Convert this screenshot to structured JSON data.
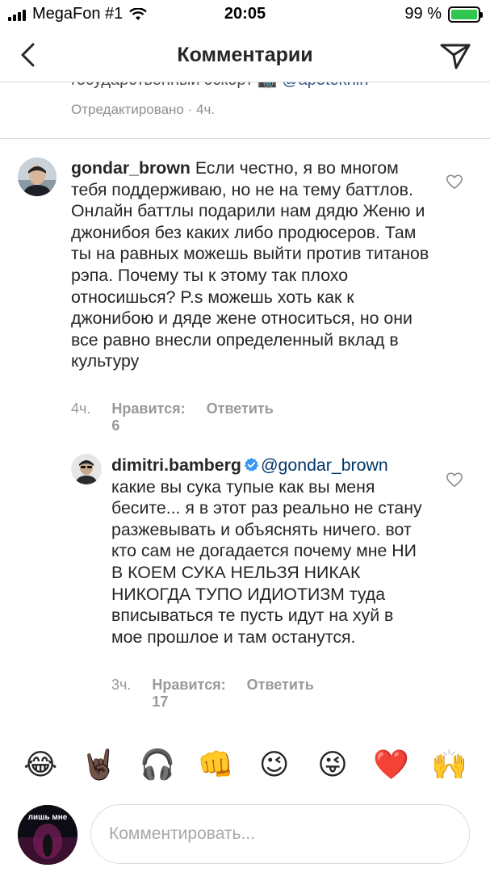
{
  "status_bar": {
    "carrier": "MegaFon #1",
    "time": "20:05",
    "battery": "99 %",
    "battery_level": 0.99
  },
  "header": {
    "title": "Комментарии",
    "back_icon": "chevron-left-icon",
    "send_icon": "paper-plane-icon"
  },
  "previous_comment": {
    "clipped_text": "государственный эскорт 📷",
    "clipped_mention": "@apotekhin",
    "edited_label": "Отредактировано",
    "separator": " · ",
    "time": "4ч."
  },
  "comments": [
    {
      "username": "gondar_brown",
      "text": "Если честно, я во многом тебя поддерживаю, но не на тему баттлов. Онлайн баттлы подарили нам дядю Женю и джонибоя без каких либо продюсеров. Там ты на равных можешь выйти против титанов рэпа. Почему ты к этому так плохо относишься? P.s можешь хоть как к джонибою и дяде жене относиться, но они все равно внесли определенный вклад в культуру",
      "time": "4ч.",
      "likes": "Нравится: 6",
      "reply": "Ответить"
    },
    {
      "username": "dimitri.bamberg",
      "verified": true,
      "mention": "@gondar_brown",
      "text": "какие вы сука тупые как вы меня бесите... я в этот раз реально не стану разжевывать и объяснять ничего. вот кто сам не догадается почему мне НИ В КОЕМ СУКА НЕЛЬЗЯ НИКАК НИКОГДА ТУПО ИДИОТИЗМ туда вписываться те пусть идут на хуй в мое прошлое и там останутся.",
      "time": "3ч.",
      "likes": "Нравится: 17",
      "reply": "Ответить"
    }
  ],
  "emoji_bar": [
    "😂",
    "🤘🏿",
    "🎧",
    "👊",
    "😉",
    "😜",
    "❤️",
    "🙌"
  ],
  "compose": {
    "placeholder": "Комментировать...",
    "avatar_text": "лишь мне"
  },
  "colors": {
    "text": "#262626",
    "secondary": "#8e8e8e",
    "link": "#003569",
    "verified": "#3897f0",
    "divider": "#dbdbdb"
  }
}
